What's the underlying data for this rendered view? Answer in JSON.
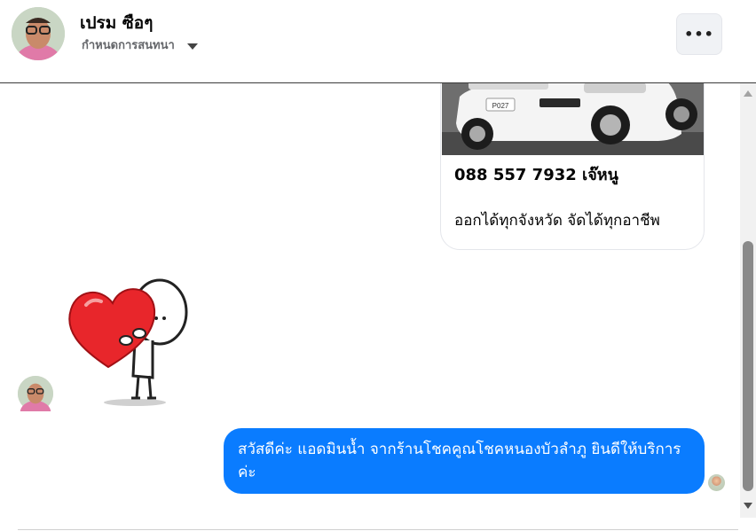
{
  "header": {
    "name": "เปรม ซือๆ",
    "subtitle": "กำหนดการสนทนา",
    "more_label": "•••"
  },
  "messages": {
    "card": {
      "line1": "088 557 7932 เจ๊หนู",
      "line2": "ออกได้ทุกจังหวัด จัดได้ทุกอาชีพ",
      "plate_text": "P027"
    },
    "sticker": {
      "icon": "heart-hug-sticker"
    },
    "outgoing_text": "สวัสดีค่ะ แอดมินน้ำ จากร้านโชคคูณโชคหนองบัวลำภู ยินดีให้บริการค่ะ"
  },
  "colors": {
    "bubble": "#0a7cff",
    "heart": "#e8262b"
  }
}
